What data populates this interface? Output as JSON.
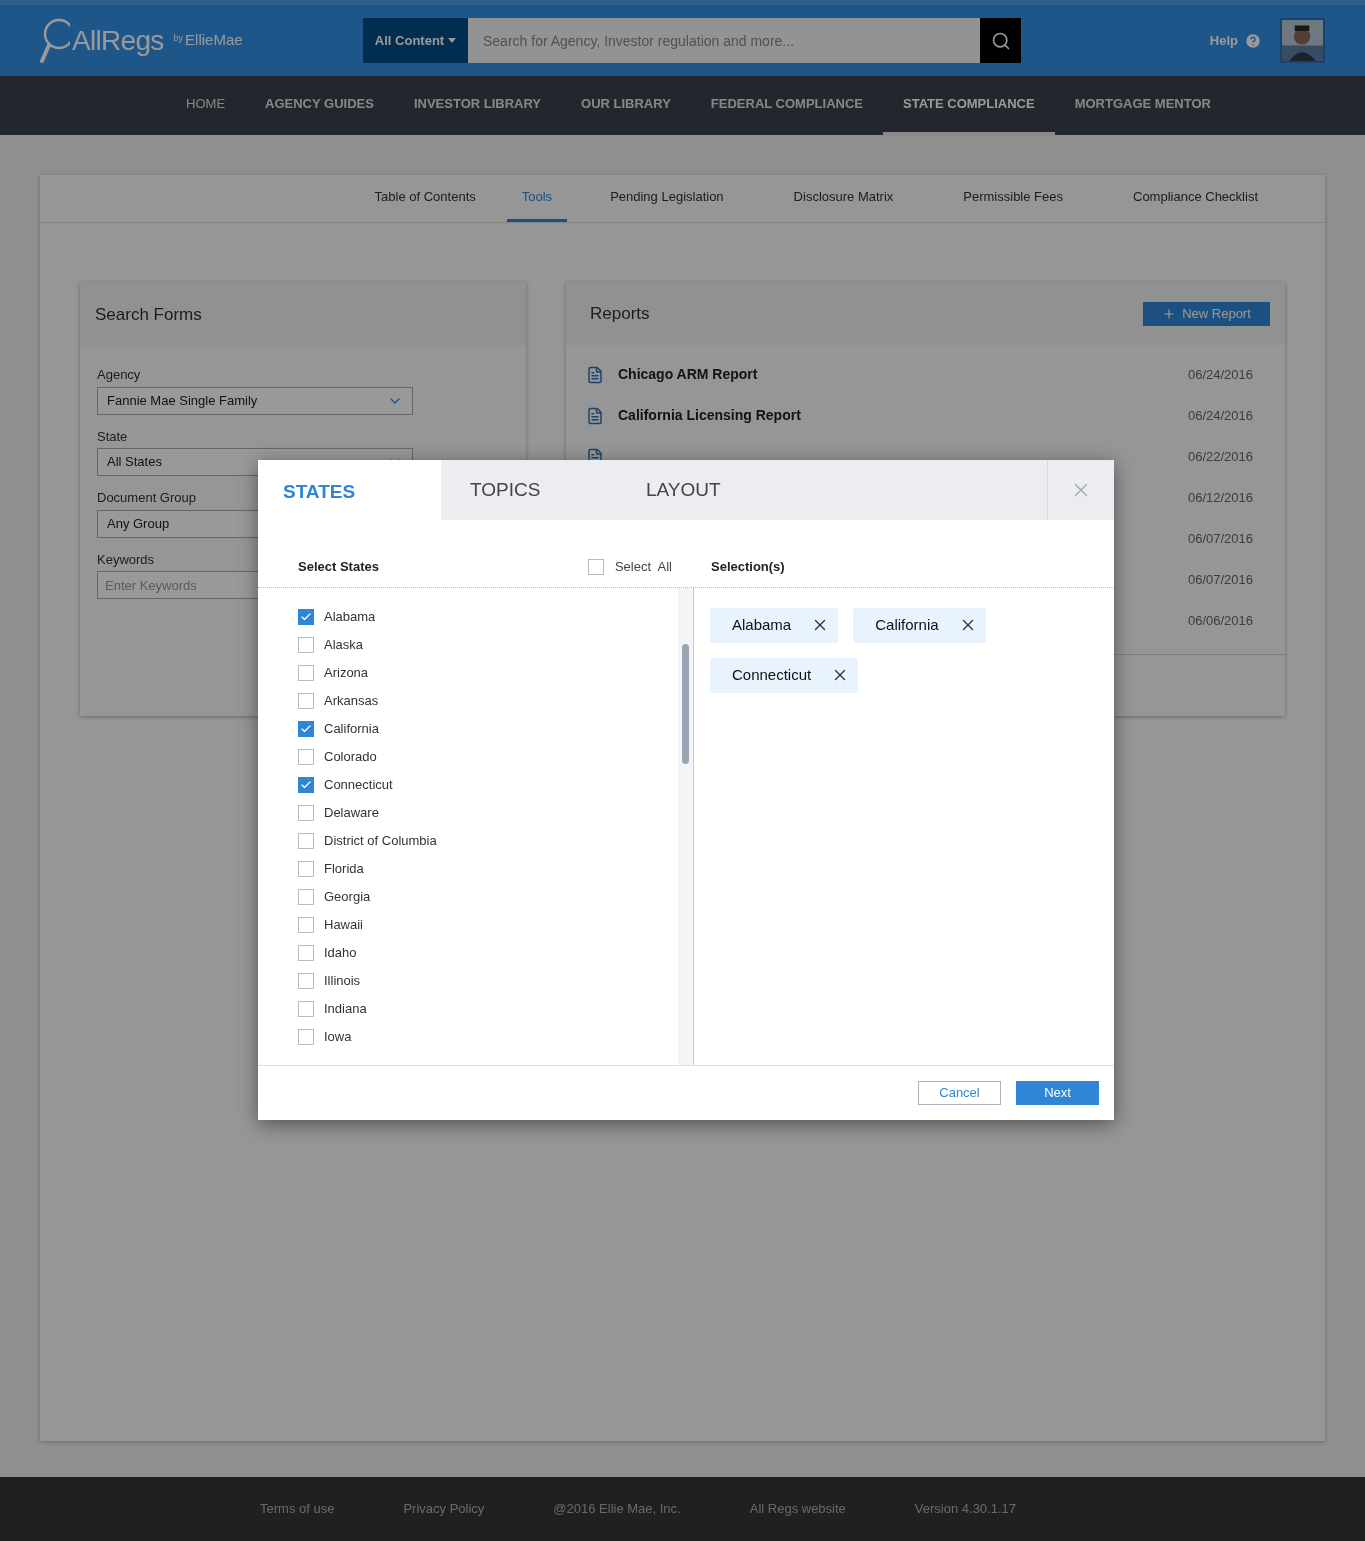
{
  "header": {
    "logo": {
      "name": "AllRegs",
      "by": "by",
      "brand": "EllieMae"
    },
    "scope_button": "All Content",
    "search": {
      "placeholder": "Search for Agency, Investor regulation and more..."
    },
    "help": "Help"
  },
  "nav": [
    {
      "label": "HOME",
      "selected": false
    },
    {
      "label": "AGENCY GUIDES",
      "selected": false
    },
    {
      "label": "INVESTOR LIBRARY",
      "selected": false
    },
    {
      "label": "OUR LIBRARY",
      "selected": false
    },
    {
      "label": "FEDERAL COMPLIANCE",
      "selected": false
    },
    {
      "label": "STATE COMPLIANCE",
      "selected": true
    },
    {
      "label": "MORTGAGE MENTOR",
      "selected": false
    }
  ],
  "subtabs": [
    {
      "label": "Table of Contents",
      "selected": false
    },
    {
      "label": "Tools",
      "selected": true
    },
    {
      "label": "Pending Legislation",
      "selected": false
    },
    {
      "label": "Disclosure Matrix",
      "selected": false
    },
    {
      "label": "Permissible Fees",
      "selected": false
    },
    {
      "label": "Compliance Checklist",
      "selected": false
    }
  ],
  "search_forms": {
    "title": "Search Forms",
    "fields": [
      {
        "kind": "select",
        "label": "Agency",
        "value": "Fannie Mae Single Family"
      },
      {
        "kind": "select",
        "label": "State",
        "value": "All States"
      },
      {
        "kind": "select_covered",
        "label": "Document Group",
        "value": "Any Group"
      },
      {
        "kind": "text",
        "label": "Keywords",
        "placeholder": "Enter Keywords"
      }
    ]
  },
  "reports": {
    "title": "Reports",
    "new_button": "New Report",
    "rows": [
      {
        "kind": "document",
        "name": "Chicago ARM Report",
        "date": "06/24/2016"
      },
      {
        "kind": "document",
        "name": "California Licensing Report",
        "date": "06/24/2016"
      },
      {
        "kind": "covered_icon",
        "date": "06/22/2016"
      },
      {
        "kind": "covered",
        "date": "06/12/2016"
      },
      {
        "kind": "covered",
        "date": "06/07/2016"
      },
      {
        "kind": "covered",
        "date": "06/07/2016"
      },
      {
        "kind": "covered",
        "date": "06/06/2016"
      }
    ]
  },
  "dialog": {
    "tabs": [
      {
        "label": "STATES",
        "selected": true
      },
      {
        "label": "TOPICS",
        "selected": false
      },
      {
        "label": "LAYOUT",
        "selected": false
      }
    ],
    "list_title": "Select States",
    "select_all": {
      "label": "Select  All",
      "checked": false
    },
    "selection_title": "Selection(s)",
    "states": [
      {
        "label": "Alabama",
        "checked": true
      },
      {
        "label": "Alaska",
        "checked": false
      },
      {
        "label": "Arizona",
        "checked": false
      },
      {
        "label": "Arkansas",
        "checked": false
      },
      {
        "label": "California",
        "checked": true
      },
      {
        "label": "Colorado",
        "checked": false
      },
      {
        "label": "Connecticut",
        "checked": true
      },
      {
        "label": "Delaware",
        "checked": false
      },
      {
        "label": "District of Columbia",
        "checked": false
      },
      {
        "label": "Florida",
        "checked": false
      },
      {
        "label": "Georgia",
        "checked": false
      },
      {
        "label": "Hawaii",
        "checked": false
      },
      {
        "label": "Idaho",
        "checked": false
      },
      {
        "label": "Illinois",
        "checked": false
      },
      {
        "label": "Indiana",
        "checked": false
      },
      {
        "label": "Iowa",
        "checked": false
      }
    ],
    "chips": [
      "Alabama",
      "California",
      "Connecticut"
    ],
    "cancel": "Cancel",
    "next": "Next"
  },
  "footer": [
    "Terms of use",
    "Privacy Policy",
    "@2016 Ellie Mae, Inc.",
    "All Regs website",
    "Version 4.30.1.17"
  ]
}
